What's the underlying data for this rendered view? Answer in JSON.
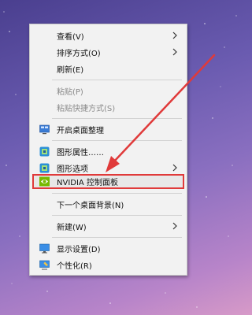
{
  "context_menu": {
    "items": [
      {
        "label": "查看(V)",
        "has_submenu": true
      },
      {
        "label": "排序方式(O)",
        "has_submenu": true
      },
      {
        "label": "刷新(E)"
      },
      {
        "label": "粘贴(P)",
        "disabled": true
      },
      {
        "label": "粘贴快捷方式(S)",
        "disabled": true
      },
      {
        "label": "开启桌面整理",
        "icon": "desktop-organize-icon"
      },
      {
        "label": "图形属性……",
        "icon": "intel-graphics-icon"
      },
      {
        "label": "图形选项",
        "icon": "intel-graphics-icon",
        "has_submenu": true
      },
      {
        "label": "NVIDIA 控制面板",
        "icon": "nvidia-icon",
        "highlighted": true
      },
      {
        "label": "下一个桌面背景(N)"
      },
      {
        "label": "新建(W)",
        "has_submenu": true
      },
      {
        "label": "显示设置(D)",
        "icon": "display-settings-icon"
      },
      {
        "label": "个性化(R)",
        "icon": "personalize-icon"
      }
    ]
  },
  "colors": {
    "highlight_border": "#e03a3a",
    "arrow": "#e03a3a",
    "menu_bg": "#f2f2f2"
  }
}
